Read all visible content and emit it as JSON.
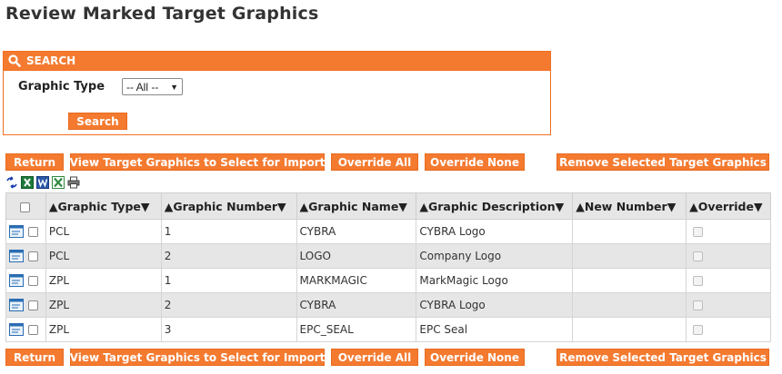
{
  "page": {
    "title": "Review Marked Target Graphics"
  },
  "search": {
    "header": "SEARCH",
    "graphic_type_label": "Graphic Type",
    "graphic_type_value": "-- All --",
    "search_button": "Search"
  },
  "actions": {
    "return": "Return",
    "view_target": "View Target Graphics to Select for Import",
    "override_all": "Override All",
    "override_none": "Override None",
    "remove_selected": "Remove Selected Target Graphics"
  },
  "export_icons": [
    "refresh-icon",
    "excel-icon",
    "word-icon",
    "csv-icon",
    "print-icon"
  ],
  "table": {
    "columns": [
      "Graphic Type",
      "Graphic Number",
      "Graphic Name",
      "Graphic Description",
      "New Number",
      "Override"
    ],
    "rows": [
      {
        "type": "PCL",
        "number": "1",
        "name": "CYBRA",
        "description": "CYBRA Logo",
        "new_number": ""
      },
      {
        "type": "PCL",
        "number": "2",
        "name": "LOGO",
        "description": "Company Logo",
        "new_number": ""
      },
      {
        "type": "ZPL",
        "number": "1",
        "name": "MARKMAGIC",
        "description": "MarkMagic Logo",
        "new_number": ""
      },
      {
        "type": "ZPL",
        "number": "2",
        "name": "CYBRA",
        "description": "CYBRA Logo",
        "new_number": ""
      },
      {
        "type": "ZPL",
        "number": "3",
        "name": "EPC_SEAL",
        "description": "EPC Seal",
        "new_number": ""
      }
    ]
  },
  "colors": {
    "accent": "#f47a30",
    "header_bg": "#e6e6e6",
    "alt_row": "#e6e6e6"
  }
}
